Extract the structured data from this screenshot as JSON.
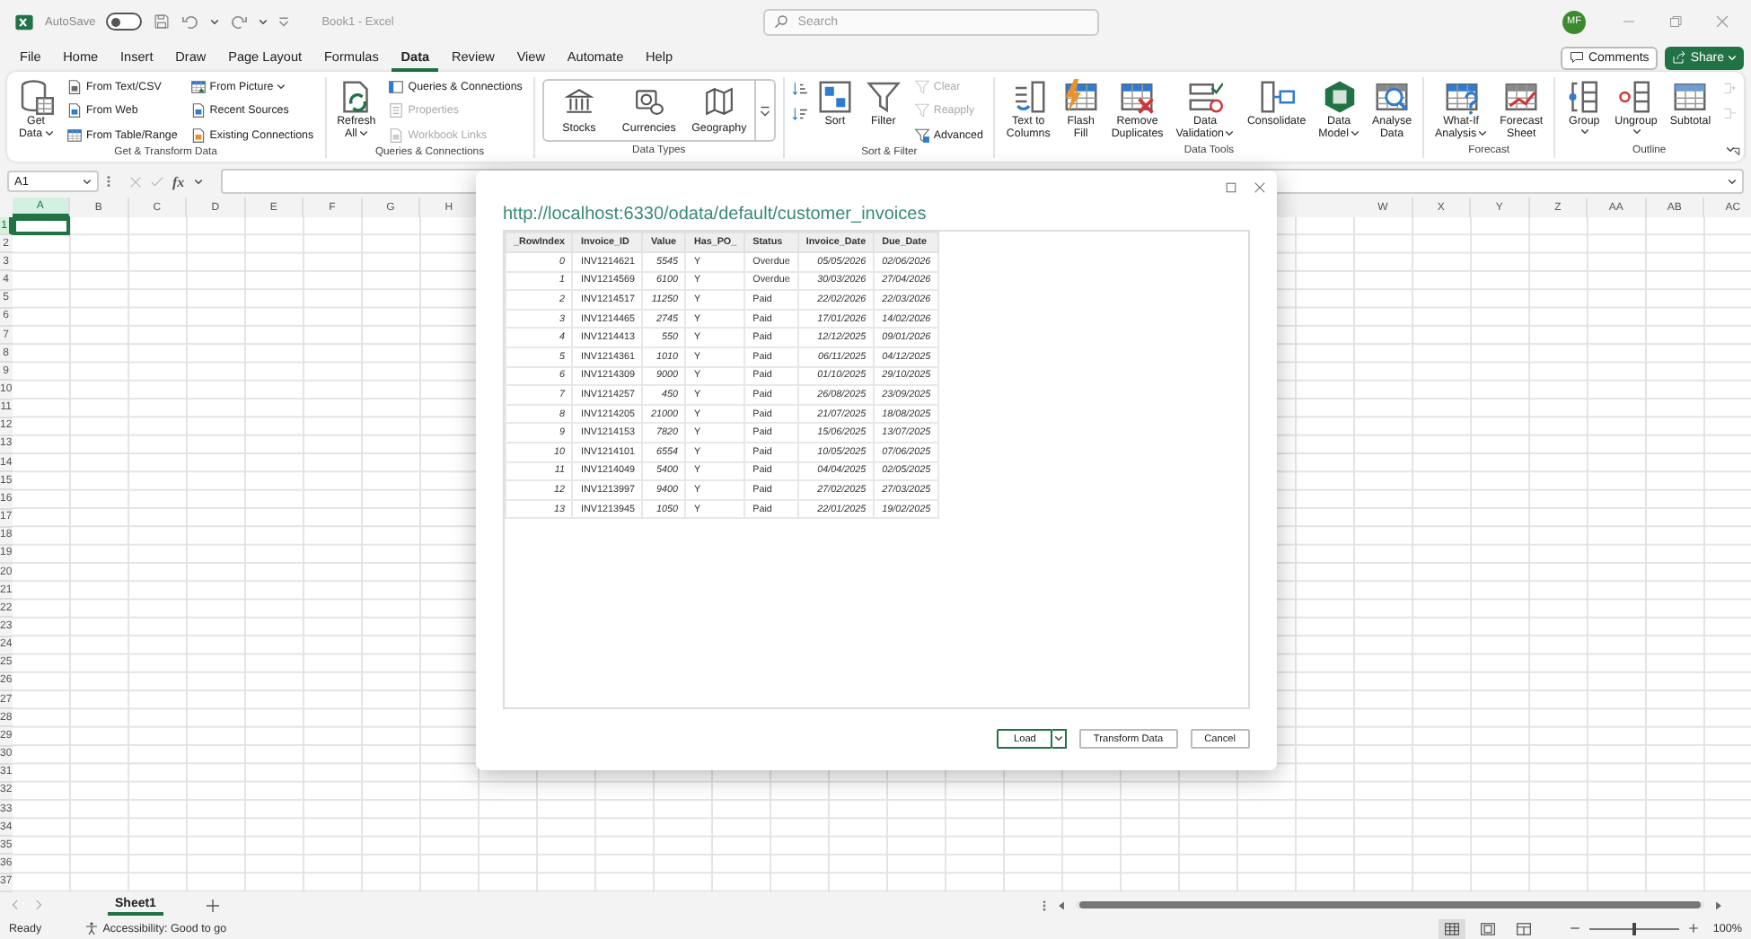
{
  "title_bar": {
    "autosave": {
      "label": "AutoSave",
      "on": false
    },
    "document_title": "Book1 - Excel",
    "search": {
      "placeholder": "Search"
    },
    "avatar": "MF"
  },
  "menu_tabs": [
    {
      "label": "File",
      "selected": false
    },
    {
      "label": "Home",
      "selected": false
    },
    {
      "label": "Insert",
      "selected": false
    },
    {
      "label": "Draw",
      "selected": false
    },
    {
      "label": "Page Layout",
      "selected": false
    },
    {
      "label": "Formulas",
      "selected": false
    },
    {
      "label": "Data",
      "selected": true
    },
    {
      "label": "Review",
      "selected": false
    },
    {
      "label": "View",
      "selected": false
    },
    {
      "label": "Automate",
      "selected": false
    },
    {
      "label": "Help",
      "selected": false
    }
  ],
  "comments_button": "Comments",
  "share_button": "Share",
  "ribbon_groups": [
    {
      "label": "Get & Transform Data",
      "kind": "buttons",
      "launcher": false,
      "items": [
        {
          "kind": "large",
          "label": "Get\nData",
          "dropdown": true,
          "disabled": false
        },
        {
          "kind": "small",
          "label": "From Text/CSV",
          "dropdown": false,
          "disabled": false
        },
        {
          "kind": "small",
          "label": "From Web",
          "dropdown": false,
          "disabled": false
        },
        {
          "kind": "small",
          "label": "From Table/Range",
          "dropdown": false,
          "disabled": false
        },
        {
          "kind": "small",
          "label": "From Picture",
          "dropdown": true,
          "disabled": false
        },
        {
          "kind": "small",
          "label": "Recent Sources",
          "dropdown": false,
          "disabled": false
        },
        {
          "kind": "small",
          "label": "Existing Connections",
          "dropdown": false,
          "disabled": false
        }
      ]
    },
    {
      "label": "Queries & Connections",
      "kind": "buttons",
      "launcher": false,
      "items": [
        {
          "kind": "large",
          "label": "Refresh\nAll",
          "dropdown": true,
          "disabled": false
        },
        {
          "kind": "small",
          "label": "Queries & Connections",
          "dropdown": false,
          "disabled": false
        },
        {
          "kind": "small",
          "label": "Properties",
          "dropdown": false,
          "disabled": true
        },
        {
          "kind": "small",
          "label": "Workbook Links",
          "dropdown": false,
          "disabled": true
        }
      ]
    },
    {
      "label": "Data Types",
      "kind": "gallery",
      "launcher": false,
      "items": [
        {
          "kind": "tile",
          "label": "Stocks",
          "dropdown": false,
          "disabled": false
        },
        {
          "kind": "tile",
          "label": "Currencies",
          "dropdown": false,
          "disabled": false
        },
        {
          "kind": "tile",
          "label": "Geography",
          "dropdown": false,
          "disabled": false
        }
      ]
    },
    {
      "label": "Sort & Filter",
      "kind": "buttons",
      "launcher": false,
      "items": [
        {
          "kind": "icon",
          "dropdown": false,
          "disabled": false
        },
        {
          "kind": "icon",
          "dropdown": false,
          "disabled": false
        },
        {
          "kind": "large",
          "label": "Sort",
          "dropdown": false,
          "disabled": false
        },
        {
          "kind": "large",
          "label": "Filter",
          "dropdown": false,
          "disabled": false
        },
        {
          "kind": "small",
          "label": "Clear",
          "dropdown": false,
          "disabled": true
        },
        {
          "kind": "small",
          "label": "Reapply",
          "dropdown": false,
          "disabled": true
        },
        {
          "kind": "small",
          "label": "Advanced",
          "dropdown": false,
          "disabled": false
        }
      ]
    },
    {
      "label": "Data Tools",
      "kind": "buttons",
      "launcher": false,
      "items": [
        {
          "kind": "large",
          "label": "Text to\nColumns",
          "dropdown": false,
          "disabled": false
        },
        {
          "kind": "large",
          "label": "Flash\nFill",
          "dropdown": false,
          "disabled": false
        },
        {
          "kind": "large",
          "label": "Remove\nDuplicates",
          "dropdown": false,
          "disabled": false
        },
        {
          "kind": "large",
          "label": "Data\nValidation",
          "dropdown": true,
          "disabled": false
        },
        {
          "kind": "large",
          "label": "Consolidate",
          "dropdown": false,
          "disabled": false
        },
        {
          "kind": "large",
          "label": "Data\nModel",
          "dropdown": true,
          "disabled": false
        },
        {
          "kind": "large",
          "label": "Analyse\nData",
          "dropdown": false,
          "disabled": false
        }
      ]
    },
    {
      "label": "Forecast",
      "kind": "buttons",
      "launcher": false,
      "items": [
        {
          "kind": "large",
          "label": "What-If\nAnalysis",
          "dropdown": true,
          "disabled": false
        },
        {
          "kind": "large",
          "label": "Forecast\nSheet",
          "dropdown": false,
          "disabled": false
        }
      ]
    },
    {
      "label": "Outline",
      "kind": "buttons",
      "launcher": true,
      "items": [
        {
          "kind": "large",
          "label": "Group",
          "dropdown": true,
          "disabled": false
        },
        {
          "kind": "large",
          "label": "Ungroup",
          "dropdown": true,
          "disabled": false
        },
        {
          "kind": "large",
          "label": "Subtotal",
          "dropdown": false,
          "disabled": false
        },
        {
          "kind": "icon",
          "dropdown": false,
          "disabled": true
        },
        {
          "kind": "icon",
          "dropdown": false,
          "disabled": true
        }
      ]
    }
  ],
  "formula_bar": {
    "name_box": "A1",
    "function_button": "fx"
  },
  "columns_left": [
    {
      "label": "A",
      "selected": true
    },
    {
      "label": "B",
      "selected": false
    },
    {
      "label": "C",
      "selected": false
    },
    {
      "label": "D",
      "selected": false
    },
    {
      "label": "E",
      "selected": false
    },
    {
      "label": "F",
      "selected": false
    },
    {
      "label": "G",
      "selected": false
    },
    {
      "label": "H",
      "selected": false
    }
  ],
  "columns_right": [
    {
      "label": "W",
      "selected": false
    },
    {
      "label": "X",
      "selected": false
    },
    {
      "label": "Y",
      "selected": false
    },
    {
      "label": "Z",
      "selected": false
    },
    {
      "label": "AA",
      "selected": false
    },
    {
      "label": "AB",
      "selected": false
    },
    {
      "label": "AC",
      "selected": false
    }
  ],
  "rows": [
    {
      "label": "1",
      "selected": true
    },
    {
      "label": "2",
      "selected": false
    },
    {
      "label": "3",
      "selected": false
    },
    {
      "label": "4",
      "selected": false
    },
    {
      "label": "5",
      "selected": false
    },
    {
      "label": "6",
      "selected": false
    },
    {
      "label": "7",
      "selected": false
    },
    {
      "label": "8",
      "selected": false
    },
    {
      "label": "9",
      "selected": false
    },
    {
      "label": "10",
      "selected": false
    },
    {
      "label": "11",
      "selected": false
    },
    {
      "label": "12",
      "selected": false
    },
    {
      "label": "13",
      "selected": false
    },
    {
      "label": "14",
      "selected": false
    },
    {
      "label": "15",
      "selected": false
    },
    {
      "label": "16",
      "selected": false
    },
    {
      "label": "17",
      "selected": false
    },
    {
      "label": "18",
      "selected": false
    },
    {
      "label": "19",
      "selected": false
    },
    {
      "label": "20",
      "selected": false
    },
    {
      "label": "21",
      "selected": false
    },
    {
      "label": "22",
      "selected": false
    },
    {
      "label": "23",
      "selected": false
    },
    {
      "label": "24",
      "selected": false
    },
    {
      "label": "25",
      "selected": false
    },
    {
      "label": "26",
      "selected": false
    },
    {
      "label": "27",
      "selected": false
    },
    {
      "label": "28",
      "selected": false
    },
    {
      "label": "29",
      "selected": false
    },
    {
      "label": "30",
      "selected": false
    },
    {
      "label": "31",
      "selected": false
    },
    {
      "label": "32",
      "selected": false
    },
    {
      "label": "33",
      "selected": false
    },
    {
      "label": "34",
      "selected": false
    },
    {
      "label": "35",
      "selected": false
    },
    {
      "label": "36",
      "selected": false
    },
    {
      "label": "37",
      "selected": false
    }
  ],
  "dialog": {
    "title": "http://localhost:6330/odata/default/customer_invoices",
    "columns": [
      {
        "label": "_RowIndex",
        "kind": "number"
      },
      {
        "label": "Invoice_ID",
        "kind": "text"
      },
      {
        "label": "Value",
        "kind": "number"
      },
      {
        "label": "Has_PO_",
        "kind": "text"
      },
      {
        "label": "Status",
        "kind": "text"
      },
      {
        "label": "Invoice_Date",
        "kind": "number"
      },
      {
        "label": "Due_Date",
        "kind": "number"
      }
    ],
    "rows": [
      [
        "0",
        "INV1214621",
        "5545",
        "Y",
        "Overdue",
        "05/05/2026",
        "02/06/2026"
      ],
      [
        "1",
        "INV1214569",
        "6100",
        "Y",
        "Overdue",
        "30/03/2026",
        "27/04/2026"
      ],
      [
        "2",
        "INV1214517",
        "11250",
        "Y",
        "Paid",
        "22/02/2026",
        "22/03/2026"
      ],
      [
        "3",
        "INV1214465",
        "2745",
        "Y",
        "Paid",
        "17/01/2026",
        "14/02/2026"
      ],
      [
        "4",
        "INV1214413",
        "550",
        "Y",
        "Paid",
        "12/12/2025",
        "09/01/2026"
      ],
      [
        "5",
        "INV1214361",
        "1010",
        "Y",
        "Paid",
        "06/11/2025",
        "04/12/2025"
      ],
      [
        "6",
        "INV1214309",
        "9000",
        "Y",
        "Paid",
        "01/10/2025",
        "29/10/2025"
      ],
      [
        "7",
        "INV1214257",
        "450",
        "Y",
        "Paid",
        "26/08/2025",
        "23/09/2025"
      ],
      [
        "8",
        "INV1214205",
        "21000",
        "Y",
        "Paid",
        "21/07/2025",
        "18/08/2025"
      ],
      [
        "9",
        "INV1214153",
        "7820",
        "Y",
        "Paid",
        "15/06/2025",
        "13/07/2025"
      ],
      [
        "10",
        "INV1214101",
        "6554",
        "Y",
        "Paid",
        "10/05/2025",
        "07/06/2025"
      ],
      [
        "11",
        "INV1214049",
        "5400",
        "Y",
        "Paid",
        "04/04/2025",
        "02/05/2025"
      ],
      [
        "12",
        "INV1213997",
        "9400",
        "Y",
        "Paid",
        "27/02/2025",
        "27/03/2025"
      ],
      [
        "13",
        "INV1213945",
        "1050",
        "Y",
        "Paid",
        "22/01/2025",
        "19/02/2025"
      ]
    ],
    "buttons": [
      {
        "label": "Load",
        "kind": "split",
        "default": true
      },
      {
        "label": "Transform Data",
        "kind": "plain",
        "default": false
      },
      {
        "label": "Cancel",
        "kind": "plain",
        "default": false
      }
    ]
  },
  "sheet_tabs": [
    {
      "label": "Sheet1",
      "selected": true
    }
  ],
  "status_bar": {
    "ready": "Ready",
    "accessibility": "Accessibility: Good to go",
    "views": [
      {
        "selected": true
      },
      {
        "selected": false
      },
      {
        "selected": false
      }
    ],
    "zoom": {
      "level": 0.5,
      "label": "100%"
    }
  }
}
